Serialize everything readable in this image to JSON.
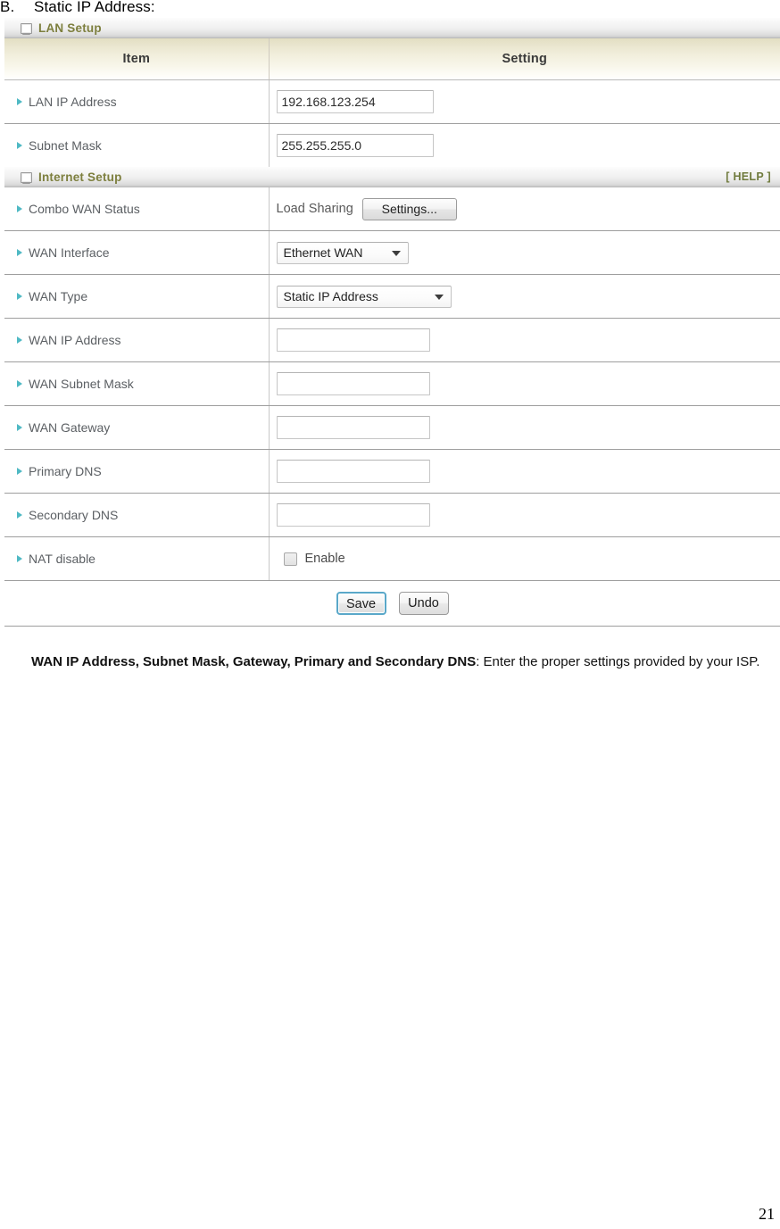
{
  "document": {
    "heading_label": "B.",
    "heading_text": "Static IP Address:",
    "page_number": "21",
    "caption_bold": "WAN IP Address, Subnet Mask, Gateway, Primary and Secondary DNS",
    "caption_rest": ": Enter the proper settings provided by your ISP."
  },
  "colors": {
    "section_title": "#7d7f3e",
    "help_link": "#6f7a3c",
    "bullet_arrow": "#4fb9c4",
    "header_beige": "#eae6cf",
    "save_focus_ring": "#5aa8c9"
  },
  "panel": {
    "table_headers": {
      "item": "Item",
      "setting": "Setting"
    },
    "lan_section": {
      "title": "LAN Setup",
      "icon": "monitor-icon",
      "rows": [
        {
          "label": "LAN IP Address",
          "value": "192.168.123.254"
        },
        {
          "label": "Subnet Mask",
          "value": "255.255.255.0"
        }
      ]
    },
    "internet_section": {
      "title": "Internet Setup",
      "icon": "monitor-icon",
      "help_label": "[ HELP ]",
      "combo_wan": {
        "label": "Combo WAN Status",
        "mode_text": "Load Sharing",
        "settings_button": "Settings..."
      },
      "wan_interface": {
        "label": "WAN Interface",
        "selected": "Ethernet WAN"
      },
      "wan_type": {
        "label": "WAN Type",
        "selected": "Static IP Address"
      },
      "text_rows": [
        {
          "label": "WAN IP Address",
          "value": "",
          "placeholder": ""
        },
        {
          "label": "WAN Subnet Mask",
          "value": "",
          "placeholder": ""
        },
        {
          "label": "WAN Gateway",
          "value": "",
          "placeholder": ""
        },
        {
          "label": "Primary DNS",
          "value": "",
          "placeholder": ""
        },
        {
          "label": "Secondary DNS",
          "value": "",
          "placeholder": ""
        }
      ],
      "nat_disable": {
        "label": "NAT disable",
        "checkbox_label": "Enable",
        "checked": false
      }
    },
    "buttons": {
      "save": "Save",
      "undo": "Undo"
    }
  }
}
